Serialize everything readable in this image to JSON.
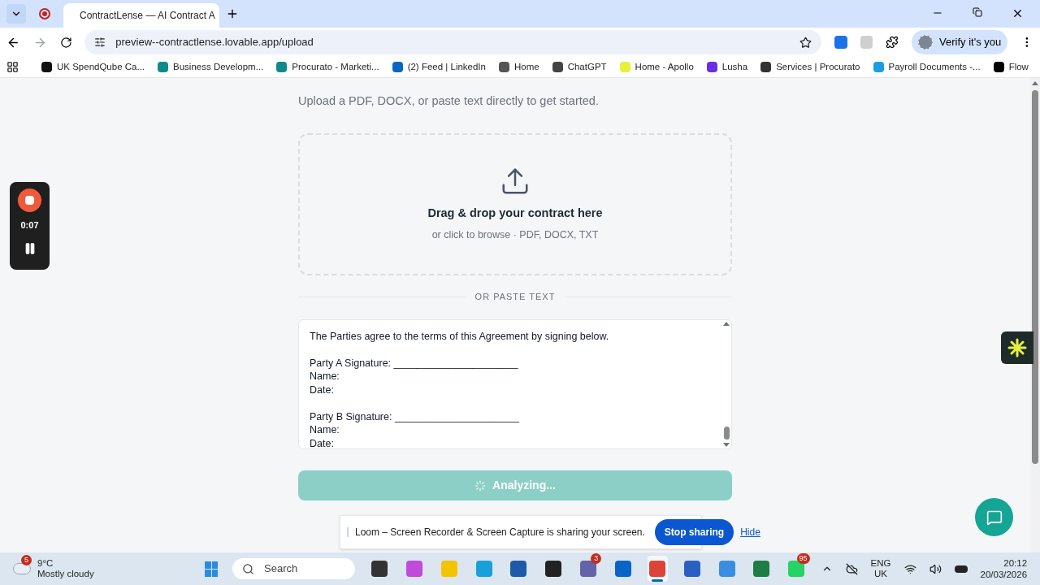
{
  "browser": {
    "tab": {
      "title": "ContractLense — AI Contract A",
      "selected": true
    },
    "url": "preview--contractlense.lovable.app/upload",
    "profile_button": "Verify it's you",
    "bookmarks": [
      {
        "label": "UK SpendQube Ca...",
        "color": "#111111"
      },
      {
        "label": "Business Developm...",
        "color": "#0f8a8a"
      },
      {
        "label": "Procurato - Marketi...",
        "color": "#0f8a8a"
      },
      {
        "label": "(2) Feed | LinkedIn",
        "color": "#0a66c2"
      },
      {
        "label": "Home",
        "color": "#555555"
      },
      {
        "label": "ChatGPT",
        "color": "#444444"
      },
      {
        "label": "Home - Apollo",
        "color": "#e5f23a"
      },
      {
        "label": "Lusha",
        "color": "#6a2ee8"
      },
      {
        "label": "Services | Procurato",
        "color": "#333333"
      },
      {
        "label": "Payroll Documents -...",
        "color": "#1b9de2"
      },
      {
        "label": "Flow",
        "color": "#000000"
      }
    ]
  },
  "page": {
    "subtitle": "Upload a PDF, DOCX, or paste text directly to get started.",
    "dropzone": {
      "title": "Drag & drop your contract here",
      "hint": "or click to browse · PDF, DOCX, TXT"
    },
    "divider": "OR PASTE TEXT",
    "contract_text": [
      [
        "The Parties agree to the terms of this Agreement by signing below."
      ],
      [
        "Party A Signature: ______________________",
        "Name:",
        "Date:"
      ],
      [
        "Party B Signature: ______________________",
        "Name:",
        "Date:"
      ]
    ],
    "analyze_button": {
      "label": "Analyzing...",
      "disabled": true
    }
  },
  "recorder": {
    "time": "0:07"
  },
  "share_bar": {
    "message": "Loom – Screen Recorder & Screen Capture is sharing your screen.",
    "stop": "Stop sharing",
    "hide": "Hide"
  },
  "taskbar": {
    "weather": {
      "badge": "5",
      "temp": "9°C",
      "condition": "Mostly cloudy"
    },
    "search": "Search",
    "apps": [
      {
        "color": "#333333"
      },
      {
        "color": "#c04bd8"
      },
      {
        "color": "#f5c400"
      },
      {
        "color": "#1aa0d8"
      },
      {
        "color": "#1e5aa8"
      },
      {
        "color": "#222222"
      },
      {
        "color": "#6264a7",
        "badge": "3"
      },
      {
        "color": "#0a64c8"
      },
      {
        "color": "#db4437",
        "selected": true
      },
      {
        "color": "#2b5fc4"
      },
      {
        "color": "#3a8ee0"
      },
      {
        "color": "#1e7c45"
      },
      {
        "color": "#25d366",
        "badge": "95"
      }
    ],
    "language": [
      "ENG",
      "UK"
    ],
    "time": "20:12",
    "date": "20/03/2026"
  }
}
